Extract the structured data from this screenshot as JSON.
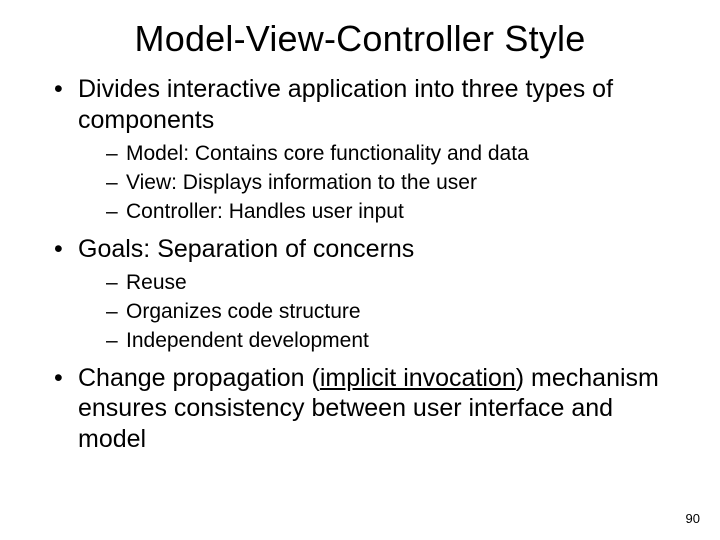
{
  "title": "Model-View-Controller Style",
  "bullets": [
    {
      "text": "Divides interactive application into three types of components",
      "sub": [
        "Model: Contains core functionality and data",
        "View: Displays information to the user",
        "Controller: Handles user input"
      ]
    },
    {
      "text": "Goals: Separation of concerns",
      "sub": [
        "Reuse",
        "Organizes code structure",
        "Independent development"
      ]
    },
    {
      "pre": "Change propagation (",
      "underlined": "implicit invocation",
      "post": ") mechanism ensures consistency between user interface and model",
      "sub": []
    }
  ],
  "page_number": "90"
}
